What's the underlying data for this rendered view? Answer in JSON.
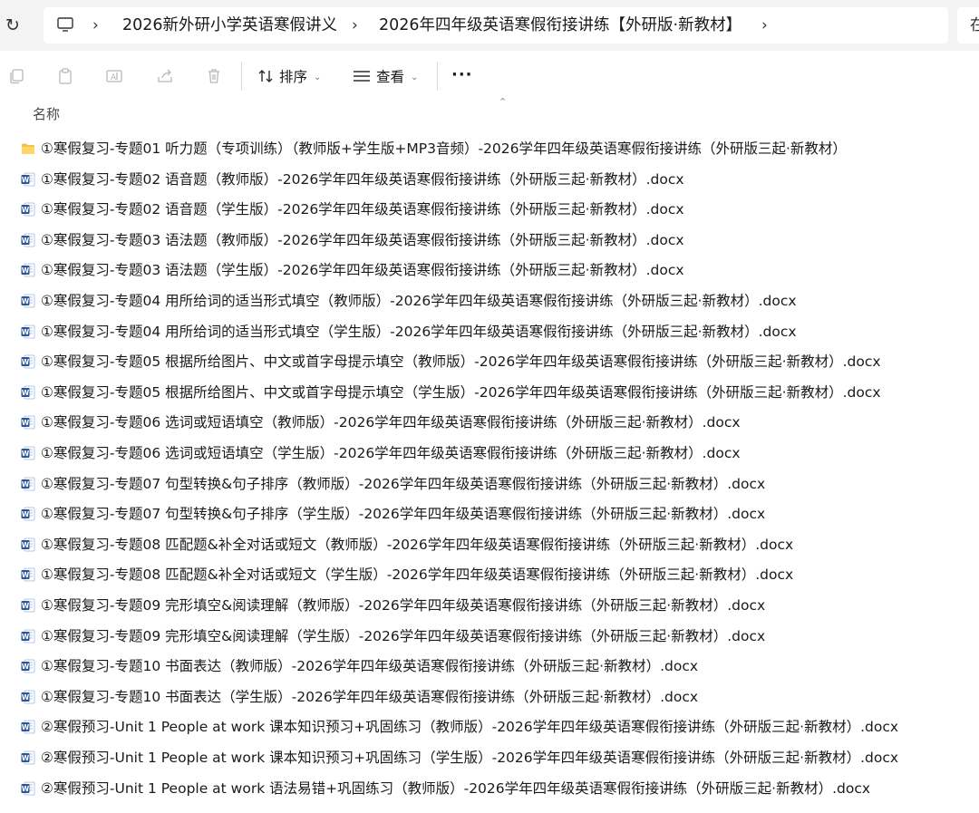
{
  "address_bar": {
    "breadcrumbs": [
      "2026新外研小学英语寒假讲义",
      "2026年四年级英语寒假衔接讲练【外研版·新教材】"
    ],
    "search_char": "在"
  },
  "toolbar": {
    "sort_label": "排序",
    "view_label": "查看",
    "more_label": "···"
  },
  "columns": {
    "name_header": "名称"
  },
  "files": [
    {
      "type": "folder",
      "name": "①寒假复习-专题01 听力题（专项训练）（教师版+学生版+MP3音频）-2026学年四年级英语寒假衔接讲练（外研版三起·新教材）"
    },
    {
      "type": "docx",
      "name": "①寒假复习-专题02 语音题（教师版）-2026学年四年级英语寒假衔接讲练（外研版三起·新教材）.docx"
    },
    {
      "type": "docx",
      "name": "①寒假复习-专题02 语音题（学生版）-2026学年四年级英语寒假衔接讲练（外研版三起·新教材）.docx"
    },
    {
      "type": "docx",
      "name": "①寒假复习-专题03 语法题（教师版）-2026学年四年级英语寒假衔接讲练（外研版三起·新教材）.docx"
    },
    {
      "type": "docx",
      "name": "①寒假复习-专题03 语法题（学生版）-2026学年四年级英语寒假衔接讲练（外研版三起·新教材）.docx"
    },
    {
      "type": "docx",
      "name": "①寒假复习-专题04 用所给词的适当形式填空（教师版）-2026学年四年级英语寒假衔接讲练（外研版三起·新教材）.docx"
    },
    {
      "type": "docx",
      "name": "①寒假复习-专题04 用所给词的适当形式填空（学生版）-2026学年四年级英语寒假衔接讲练（外研版三起·新教材）.docx"
    },
    {
      "type": "docx",
      "name": "①寒假复习-专题05 根据所给图片、中文或首字母提示填空（教师版）-2026学年四年级英语寒假衔接讲练（外研版三起·新教材）.docx"
    },
    {
      "type": "docx",
      "name": "①寒假复习-专题05 根据所给图片、中文或首字母提示填空（学生版）-2026学年四年级英语寒假衔接讲练（外研版三起·新教材）.docx"
    },
    {
      "type": "docx",
      "name": "①寒假复习-专题06 选词或短语填空（教师版）-2026学年四年级英语寒假衔接讲练（外研版三起·新教材）.docx"
    },
    {
      "type": "docx",
      "name": "①寒假复习-专题06 选词或短语填空（学生版）-2026学年四年级英语寒假衔接讲练（外研版三起·新教材）.docx"
    },
    {
      "type": "docx",
      "name": "①寒假复习-专题07 句型转换&句子排序（教师版）-2026学年四年级英语寒假衔接讲练（外研版三起·新教材）.docx"
    },
    {
      "type": "docx",
      "name": "①寒假复习-专题07 句型转换&句子排序（学生版）-2026学年四年级英语寒假衔接讲练（外研版三起·新教材）.docx"
    },
    {
      "type": "docx",
      "name": "①寒假复习-专题08 匹配题&补全对话或短文（教师版）-2026学年四年级英语寒假衔接讲练（外研版三起·新教材）.docx"
    },
    {
      "type": "docx",
      "name": "①寒假复习-专题08 匹配题&补全对话或短文（学生版）-2026学年四年级英语寒假衔接讲练（外研版三起·新教材）.docx"
    },
    {
      "type": "docx",
      "name": "①寒假复习-专题09 完形填空&阅读理解（教师版）-2026学年四年级英语寒假衔接讲练（外研版三起·新教材）.docx"
    },
    {
      "type": "docx",
      "name": "①寒假复习-专题09 完形填空&阅读理解（学生版）-2026学年四年级英语寒假衔接讲练（外研版三起·新教材）.docx"
    },
    {
      "type": "docx",
      "name": "①寒假复习-专题10 书面表达（教师版）-2026学年四年级英语寒假衔接讲练（外研版三起·新教材）.docx"
    },
    {
      "type": "docx",
      "name": "①寒假复习-专题10 书面表达（学生版）-2026学年四年级英语寒假衔接讲练（外研版三起·新教材）.docx"
    },
    {
      "type": "docx",
      "name": "②寒假预习-Unit 1 People at work 课本知识预习+巩固练习（教师版）-2026学年四年级英语寒假衔接讲练（外研版三起·新教材）.docx"
    },
    {
      "type": "docx",
      "name": "②寒假预习-Unit 1 People at work 课本知识预习+巩固练习（学生版）-2026学年四年级英语寒假衔接讲练（外研版三起·新教材）.docx"
    },
    {
      "type": "docx",
      "name": "②寒假预习-Unit 1 People at work 语法易错+巩固练习（教师版）-2026学年四年级英语寒假衔接讲练（外研版三起·新教材）.docx"
    }
  ],
  "colors": {
    "folder": "#f5c342",
    "word": "#2b579a",
    "address_bg": "#f3f3f3"
  }
}
